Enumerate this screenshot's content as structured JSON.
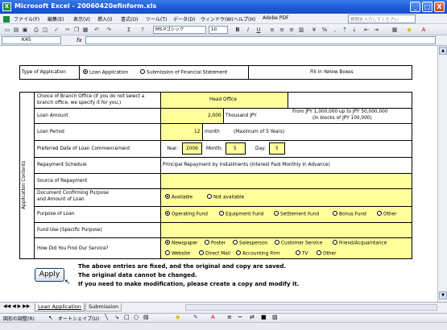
{
  "window": {
    "title": "Microsoft Excel - 20060420efinform.xls",
    "app_icon": "X",
    "minimize_label": "_",
    "restore_label": "□",
    "close_label": "X"
  },
  "menu": [
    "ファイル(F)",
    "編集(E)",
    "表示(V)",
    "挿入(I)",
    "書式(O)",
    "ツール(T)",
    "データ(D)",
    "ウィンドウ(W)",
    "ヘルプ(H)",
    "Adobe PDF"
  ],
  "help_box_placeholder": "質問を入力してください",
  "toolbar": {
    "font_name": "MS Pゴシック",
    "font_size": "10",
    "bold": "B",
    "italic": "I",
    "underline": "U"
  },
  "formula_bar": {
    "name_box": "K45",
    "fx_label": "fx"
  },
  "form": {
    "type_label": "Type of Application",
    "type_options": [
      {
        "label": "Loan Application",
        "selected": true
      },
      {
        "label": "Submission of Financial Statement",
        "selected": false
      }
    ],
    "fill_note": "Fill in Yellow Boxes",
    "side_label": "Application Contents",
    "branch_label_1": "Choice of Branch Office (If you do not select a",
    "branch_label_2": "branch office, we specify it for you.)",
    "branch_value": "Head Office",
    "loan_amount_label": "Loan Amount",
    "loan_amount_value": "2,000",
    "loan_amount_unit": "Thousand JPY",
    "loan_amount_range_1": "From JPY 1,000,000 up to JPY 50,000,000",
    "loan_amount_range_2": "(in blocks of JPY 100,000)",
    "loan_period_label": "Loan Period",
    "loan_period_value": "12",
    "loan_period_unit": "month",
    "loan_period_note": "(Maximum of 5 Years)",
    "commence_label": "Preferred Date of Loan Commencement",
    "year_label": "Year:",
    "year_value": "2006",
    "month_label": "Month:",
    "month_value": "5",
    "day_label": "Day:",
    "day_value": "5",
    "repayment_label": "Repayment Schedule",
    "repayment_value": "Principal Repayment by Installments (Interest Paid Monthly in Advance)",
    "source_label": "Source of Repayment",
    "doc_label_1": "Document Confirming Purpose",
    "doc_label_2": "and Amount of Loan",
    "doc_options": [
      {
        "label": "Available",
        "selected": true
      },
      {
        "label": "Not available",
        "selected": false
      }
    ],
    "purpose_label": "Purpose of Loan",
    "purpose_options": [
      {
        "label": "Operating Fund",
        "selected": true
      },
      {
        "label": "Equipment Fund",
        "selected": false
      },
      {
        "label": "Settlement Fund",
        "selected": false
      },
      {
        "label": "Bonus Fund",
        "selected": false
      },
      {
        "label": "Other",
        "selected": false
      }
    ],
    "fund_use_label": "Fund Use (Specific Purpose)",
    "find_label": "How Did You Find Our Service?",
    "find_options_row1": [
      {
        "label": "Newspaper",
        "selected": true
      },
      {
        "label": "Poster",
        "selected": false
      },
      {
        "label": "Salesperson",
        "selected": false
      },
      {
        "label": "Customer Service",
        "selected": false
      },
      {
        "label": "Friend/Acquaintance",
        "selected": false
      }
    ],
    "find_options_row2": [
      {
        "label": "Website",
        "selected": false
      },
      {
        "label": "Direct Mail",
        "selected": false
      },
      {
        "label": "Accounting Firm",
        "selected": false
      },
      {
        "label": "TV",
        "selected": false
      },
      {
        "label": "Other",
        "selected": false
      }
    ],
    "apply_label": "Apply",
    "notice_1": "The above entries are fixed, and the original and copy are saved.",
    "notice_2": "The original data cannot be changed.",
    "notice_3": "If you need to make modification, please create a copy and modify it."
  },
  "sheet_tabs": [
    "Loan Application",
    "Submission"
  ],
  "drawing_toolbar": {
    "draw_label": "図形の調整(R)",
    "autoshape_label": "オートシェイプ(U)"
  },
  "colors": {
    "title_bar": "#1c58d8",
    "yellow_fill": "#ffff9c"
  }
}
